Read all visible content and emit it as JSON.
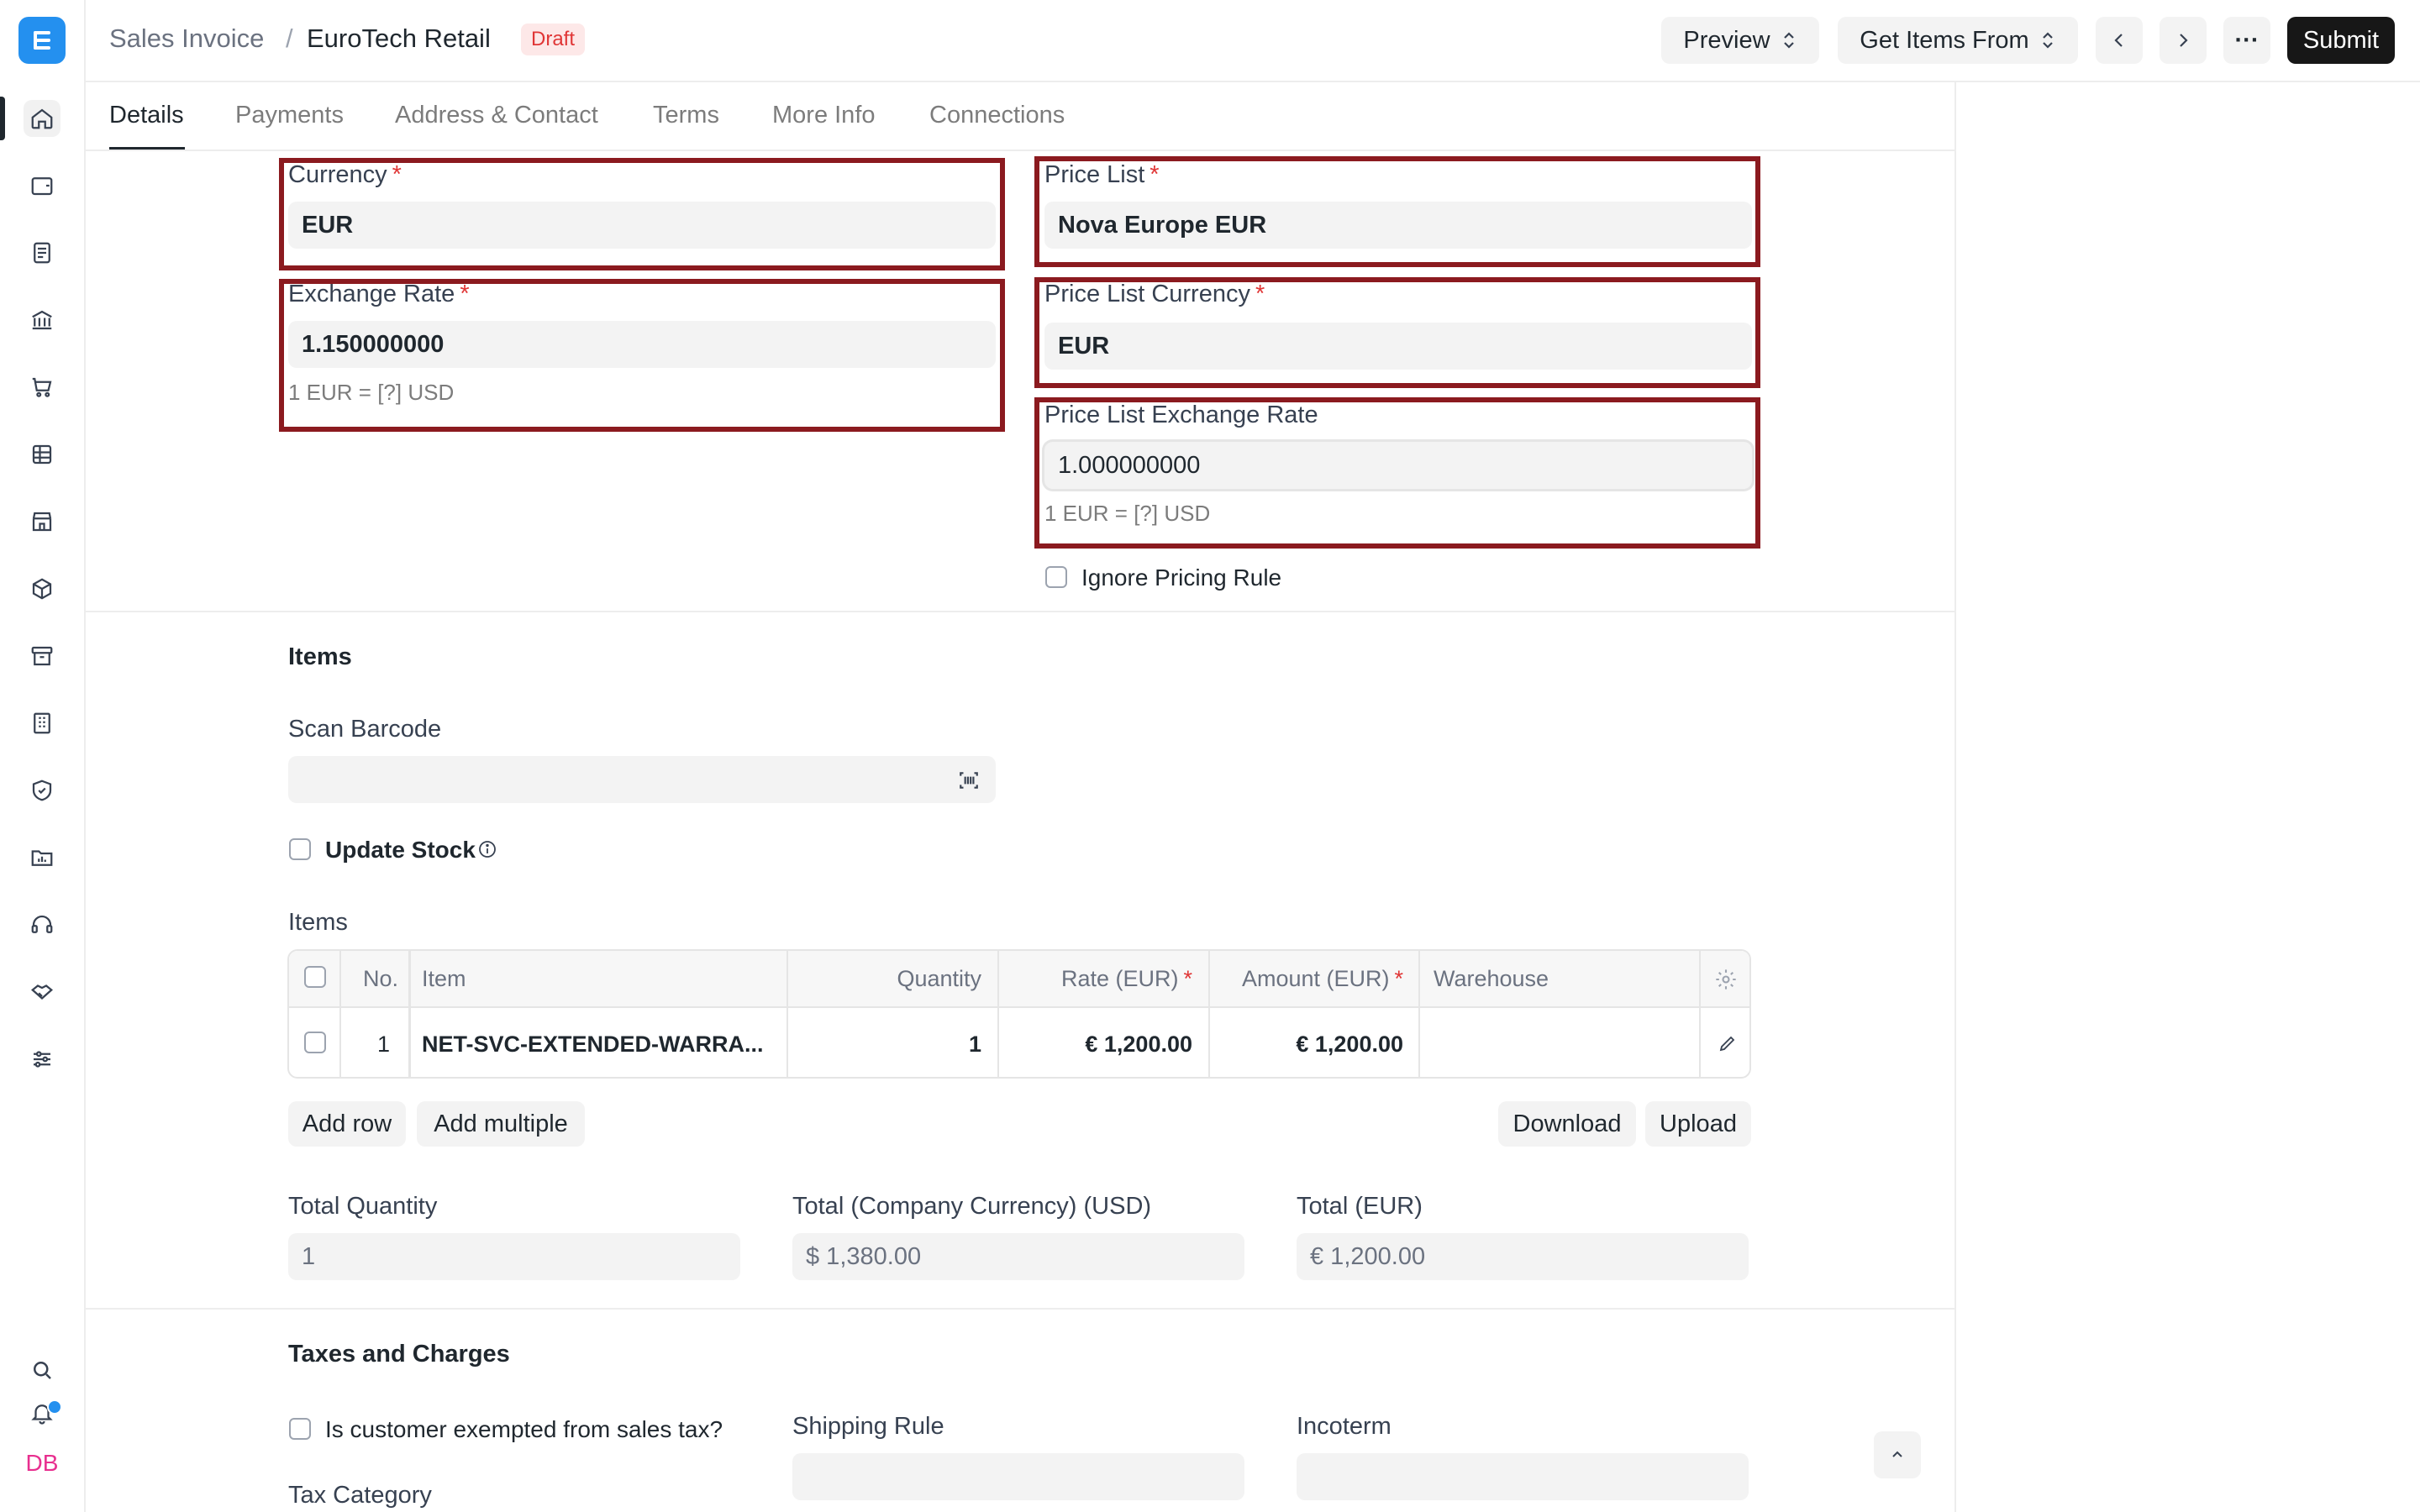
{
  "sidebar": {
    "logo": "E",
    "icons": [
      "home-icon",
      "wallet-icon",
      "document-icon",
      "bank-icon",
      "cart-icon",
      "table-icon",
      "store-icon",
      "box-icon",
      "archive-icon",
      "building-icon",
      "shield-icon",
      "folder-chart-icon",
      "headset-icon",
      "handshake-icon",
      "sliders-icon"
    ],
    "bottom_icons": [
      "search-icon",
      "bell-icon"
    ],
    "user_initials": "DB"
  },
  "header": {
    "breadcrumb": "Sales Invoice",
    "separator": "/",
    "title": "EuroTech Retail",
    "status": "Draft",
    "preview_label": "Preview",
    "get_items_label": "Get Items From",
    "more_label": "···",
    "submit_label": "Submit"
  },
  "tabs": [
    "Details",
    "Payments",
    "Address & Contact",
    "Terms",
    "More Info",
    "Connections"
  ],
  "currency": {
    "currency_label": "Currency",
    "currency_value": "EUR",
    "exchange_rate_label": "Exchange Rate",
    "exchange_rate_value": "1.150000000",
    "exchange_rate_hint": "1 EUR = [?] USD",
    "price_list_label": "Price List",
    "price_list_value": "Nova Europe EUR",
    "price_list_currency_label": "Price List Currency",
    "price_list_currency_value": "EUR",
    "plc_exchange_rate_label": "Price List Exchange Rate",
    "plc_exchange_rate_value": "1.000000000",
    "plc_exchange_rate_hint": "1 EUR = [?] USD",
    "ignore_pricing_rule_label": "Ignore Pricing Rule"
  },
  "items_section": {
    "title": "Items",
    "scan_barcode_label": "Scan Barcode",
    "update_stock_label": "Update Stock",
    "items_table_label": "Items",
    "columns": {
      "no": "No.",
      "item": "Item",
      "quantity": "Quantity",
      "rate": "Rate (EUR)",
      "amount": "Amount (EUR)",
      "warehouse": "Warehouse"
    },
    "rows": [
      {
        "no": "1",
        "item": "NET-SVC-EXTENDED-WARRA...",
        "quantity": "1",
        "rate": "€ 1,200.00",
        "amount": "€ 1,200.00",
        "warehouse": ""
      }
    ],
    "add_row_label": "Add row",
    "add_multiple_label": "Add multiple",
    "download_label": "Download",
    "upload_label": "Upload",
    "total_quantity_label": "Total Quantity",
    "total_quantity_value": "1",
    "total_company_label": "Total (Company Currency) (USD)",
    "total_company_value": "$ 1,380.00",
    "total_eur_label": "Total (EUR)",
    "total_eur_value": "€ 1,200.00"
  },
  "taxes_section": {
    "title": "Taxes and Charges",
    "exempt_label": "Is customer exempted from sales tax?",
    "shipping_rule_label": "Shipping Rule",
    "incoterm_label": "Incoterm",
    "tax_category_label": "Tax Category"
  },
  "colors": {
    "accent": "#2490ef",
    "highlight_border": "#8b1a1f",
    "required": "#e03636",
    "draft_badge_bg": "#fde8e8"
  }
}
